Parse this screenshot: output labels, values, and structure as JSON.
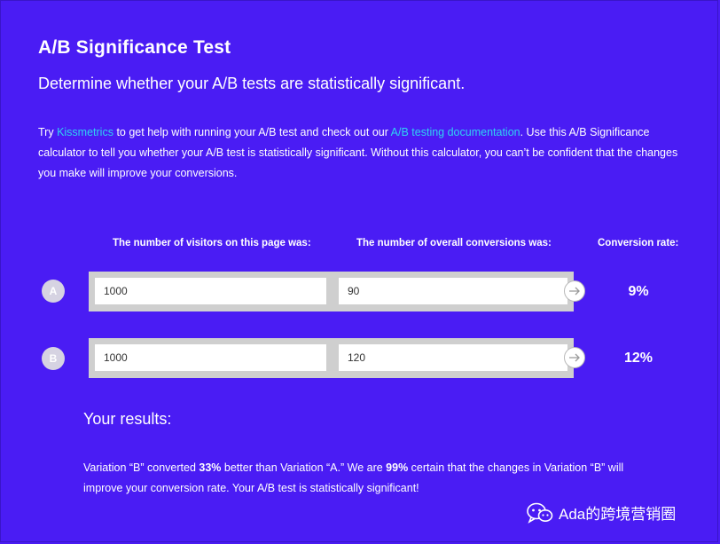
{
  "header": {
    "title": "A/B Significance Test",
    "subtitle": "Determine whether your A/B tests are statistically significant."
  },
  "intro": {
    "part1": "Try ",
    "link1": "Kissmetrics",
    "part2": " to get help with running your A/B test and check out our ",
    "link2": "A/B testing documentation",
    "part3": ". Use this A/B Significance calculator to tell you whether your A/B test is statistically significant. Without this calculator, you can’t be confident that the changes you make will improve your conversions."
  },
  "table": {
    "visitors_header": "The number of visitors on this page was:",
    "conversions_header": "The number of overall conversions was:",
    "rate_header": "Conversion rate:",
    "rows": [
      {
        "label": "A",
        "visitors": "1000",
        "conversions": "90",
        "rate": "9%"
      },
      {
        "label": "B",
        "visitors": "1000",
        "conversions": "120",
        "rate": "12%"
      }
    ]
  },
  "results": {
    "title": "Your results:",
    "s1": "Variation “B” converted ",
    "b1": "33%",
    "s2": " better than Variation “A.” We are ",
    "b2": "99%",
    "s3": " certain that the changes in Variation “B” will improve your conversion rate. Your A/B test is statistically significant!"
  },
  "watermark": {
    "icon": "wechat-icon",
    "text": "Ada的跨境营销圈"
  },
  "colors": {
    "background": "#4a1cf4",
    "link": "#2fd3f2",
    "panel": "#cfcfcf",
    "badge": "#d6d3e2"
  }
}
